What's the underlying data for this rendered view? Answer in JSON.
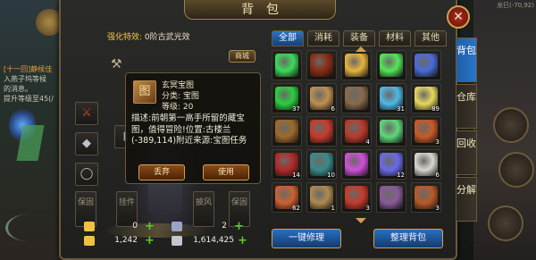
{
  "window": {
    "title": "背包",
    "close": "✕"
  },
  "world_left": {
    "chat": [
      "[十一回]静候佳",
      "入燕子坞等候",
      "的消息。",
      "提升等级至45(/"
    ]
  },
  "world_right": {
    "coords": "龙巳(-70,92)"
  },
  "equip": {
    "effect_label": "强化特效:",
    "effect_value": "0阶古武光效",
    "shop_button": "商城",
    "slots": {
      "hanger": "挂件",
      "cloak": "披风",
      "protect1": "保固",
      "protect2": "保固",
      "protect3": "保固"
    },
    "currency": [
      {
        "value": "0",
        "color": "#f0c040"
      },
      {
        "value": "2",
        "color": "#9aa4c8"
      },
      {
        "value": "1,242",
        "color": "#f0c040"
      },
      {
        "value": "1,614,425",
        "color": "#c0c8d0"
      }
    ]
  },
  "tooltip": {
    "icon": "图",
    "name": "玄冥宝图",
    "category": "分类: 宝图",
    "level": "等级: 20",
    "description": "描述:前朝第一高手所留的藏宝图，值得冒险!位置:古楼兰(-389,114)附近来源:宝图任务",
    "discard_button": "丢弃",
    "use_button": "使用"
  },
  "tabs": [
    "全部",
    "消耗",
    "装备",
    "材料",
    "其他"
  ],
  "side_tabs": [
    "背包",
    "仓库",
    "回收",
    "分解"
  ],
  "grid": {
    "cells": [
      {
        "color": "#3cdc5a",
        "count": ""
      },
      {
        "color": "#8a2c12",
        "count": ""
      },
      {
        "color": "#e6b440",
        "count": ""
      },
      {
        "color": "#55e65a",
        "count": ""
      },
      {
        "color": "#4a6ad8",
        "count": ""
      },
      {
        "color": "#2ad040",
        "count": "37"
      },
      {
        "color": "#c09050",
        "count": "6"
      },
      {
        "color": "#8a6a4a",
        "count": ""
      },
      {
        "color": "#50b8e8",
        "count": "31"
      },
      {
        "color": "#e8d860",
        "count": "89"
      },
      {
        "color": "#a0682a",
        "count": ""
      },
      {
        "color": "#c83a2a",
        "count": ""
      },
      {
        "color": "#b83a2a",
        "count": "4"
      },
      {
        "color": "#5fd87a",
        "count": ""
      },
      {
        "color": "#c85a28",
        "count": "3"
      },
      {
        "color": "#b02a2a",
        "count": "14"
      },
      {
        "color": "#3a8a8a",
        "count": "10"
      },
      {
        "color": "#d050d8",
        "count": ""
      },
      {
        "color": "#6a6ae8",
        "count": "12"
      },
      {
        "color": "#d8d8d0",
        "count": "6"
      },
      {
        "color": "#d06030",
        "count": "62"
      },
      {
        "color": "#b08a50",
        "count": "1"
      },
      {
        "color": "#c83a2a",
        "count": "3"
      },
      {
        "color": "#8a5a9a",
        "count": ""
      },
      {
        "color": "#b85a28",
        "count": "3"
      }
    ]
  },
  "actions": {
    "repair": "一键修理",
    "sort": "整理背包"
  }
}
